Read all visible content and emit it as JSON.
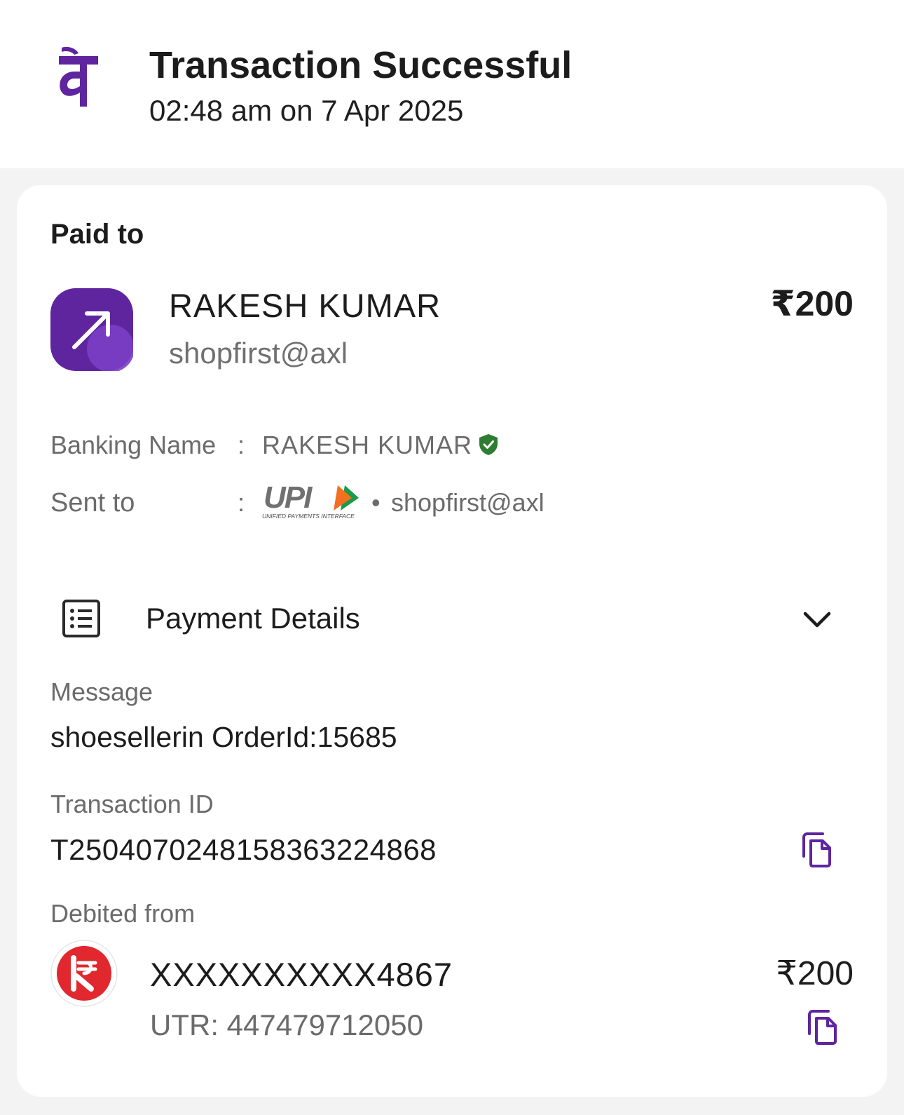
{
  "header": {
    "logo_icon": "phonepe-logo-icon",
    "title": "Transaction Successful",
    "datetime": "02:48 am on 7 Apr 2025"
  },
  "paid_to": {
    "label": "Paid to",
    "avatar_icon": "arrow-up-right-icon",
    "name": "RAKESH  KUMAR",
    "upi_id": "shopfirst@axl",
    "amount": "₹200"
  },
  "banking_name": {
    "label": "Banking Name",
    "separator": ":",
    "value": "RAKESH  KUMAR",
    "verified_icon": "verified-shield-icon"
  },
  "sent_to": {
    "label": "Sent to",
    "separator": ":",
    "upi_logo_text": "UPI",
    "upi_logo_subtext": "UNIFIED PAYMENTS INTERFACE",
    "bullet": "•",
    "value": "shopfirst@axl"
  },
  "payment_details": {
    "icon": "receipt-list-icon",
    "title": "Payment Details",
    "toggle_icon": "chevron-down-icon"
  },
  "message": {
    "label": "Message",
    "value": "shoesellerin OrderId:15685"
  },
  "transaction_id": {
    "label": "Transaction ID",
    "value": "T2504070248158363224868",
    "copy_icon": "copy-icon"
  },
  "debited_from": {
    "label": "Debited from",
    "bank_icon": "kotak-bank-logo-icon",
    "account": "XXXXXXXXXX4867",
    "utr": "UTR: 447479712050",
    "amount": "₹200",
    "copy_icon": "copy-icon"
  },
  "colors": {
    "brand_purple": "#5f259f",
    "accent_purple": "#6739b7",
    "verified_green": "#2e7d32",
    "bank_red": "#e0282e",
    "upi_orange": "#f37021",
    "upi_green": "#1a9a4a"
  }
}
